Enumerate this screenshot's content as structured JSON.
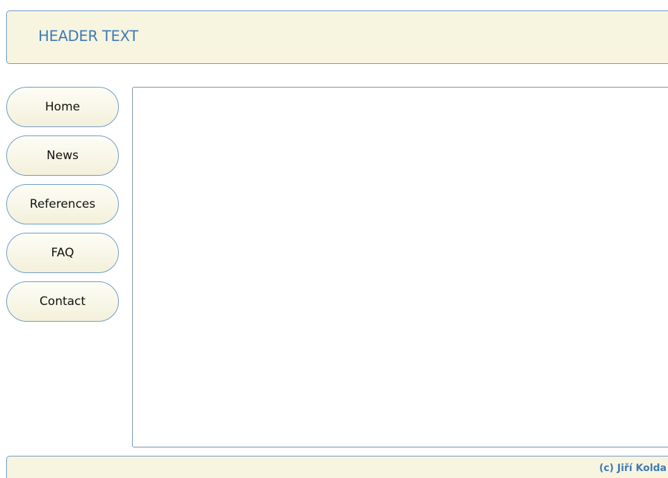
{
  "header": {
    "title": "HEADER TEXT"
  },
  "nav": {
    "items": [
      {
        "label": "Home"
      },
      {
        "label": "News"
      },
      {
        "label": "References"
      },
      {
        "label": "FAQ"
      },
      {
        "label": "Contact"
      }
    ]
  },
  "footer": {
    "copyright": "(c) Jiří Kolda"
  },
  "colors": {
    "accent": "#3f7bb5",
    "border": "#6a9ac6",
    "panel_background": "#f7f4df"
  }
}
